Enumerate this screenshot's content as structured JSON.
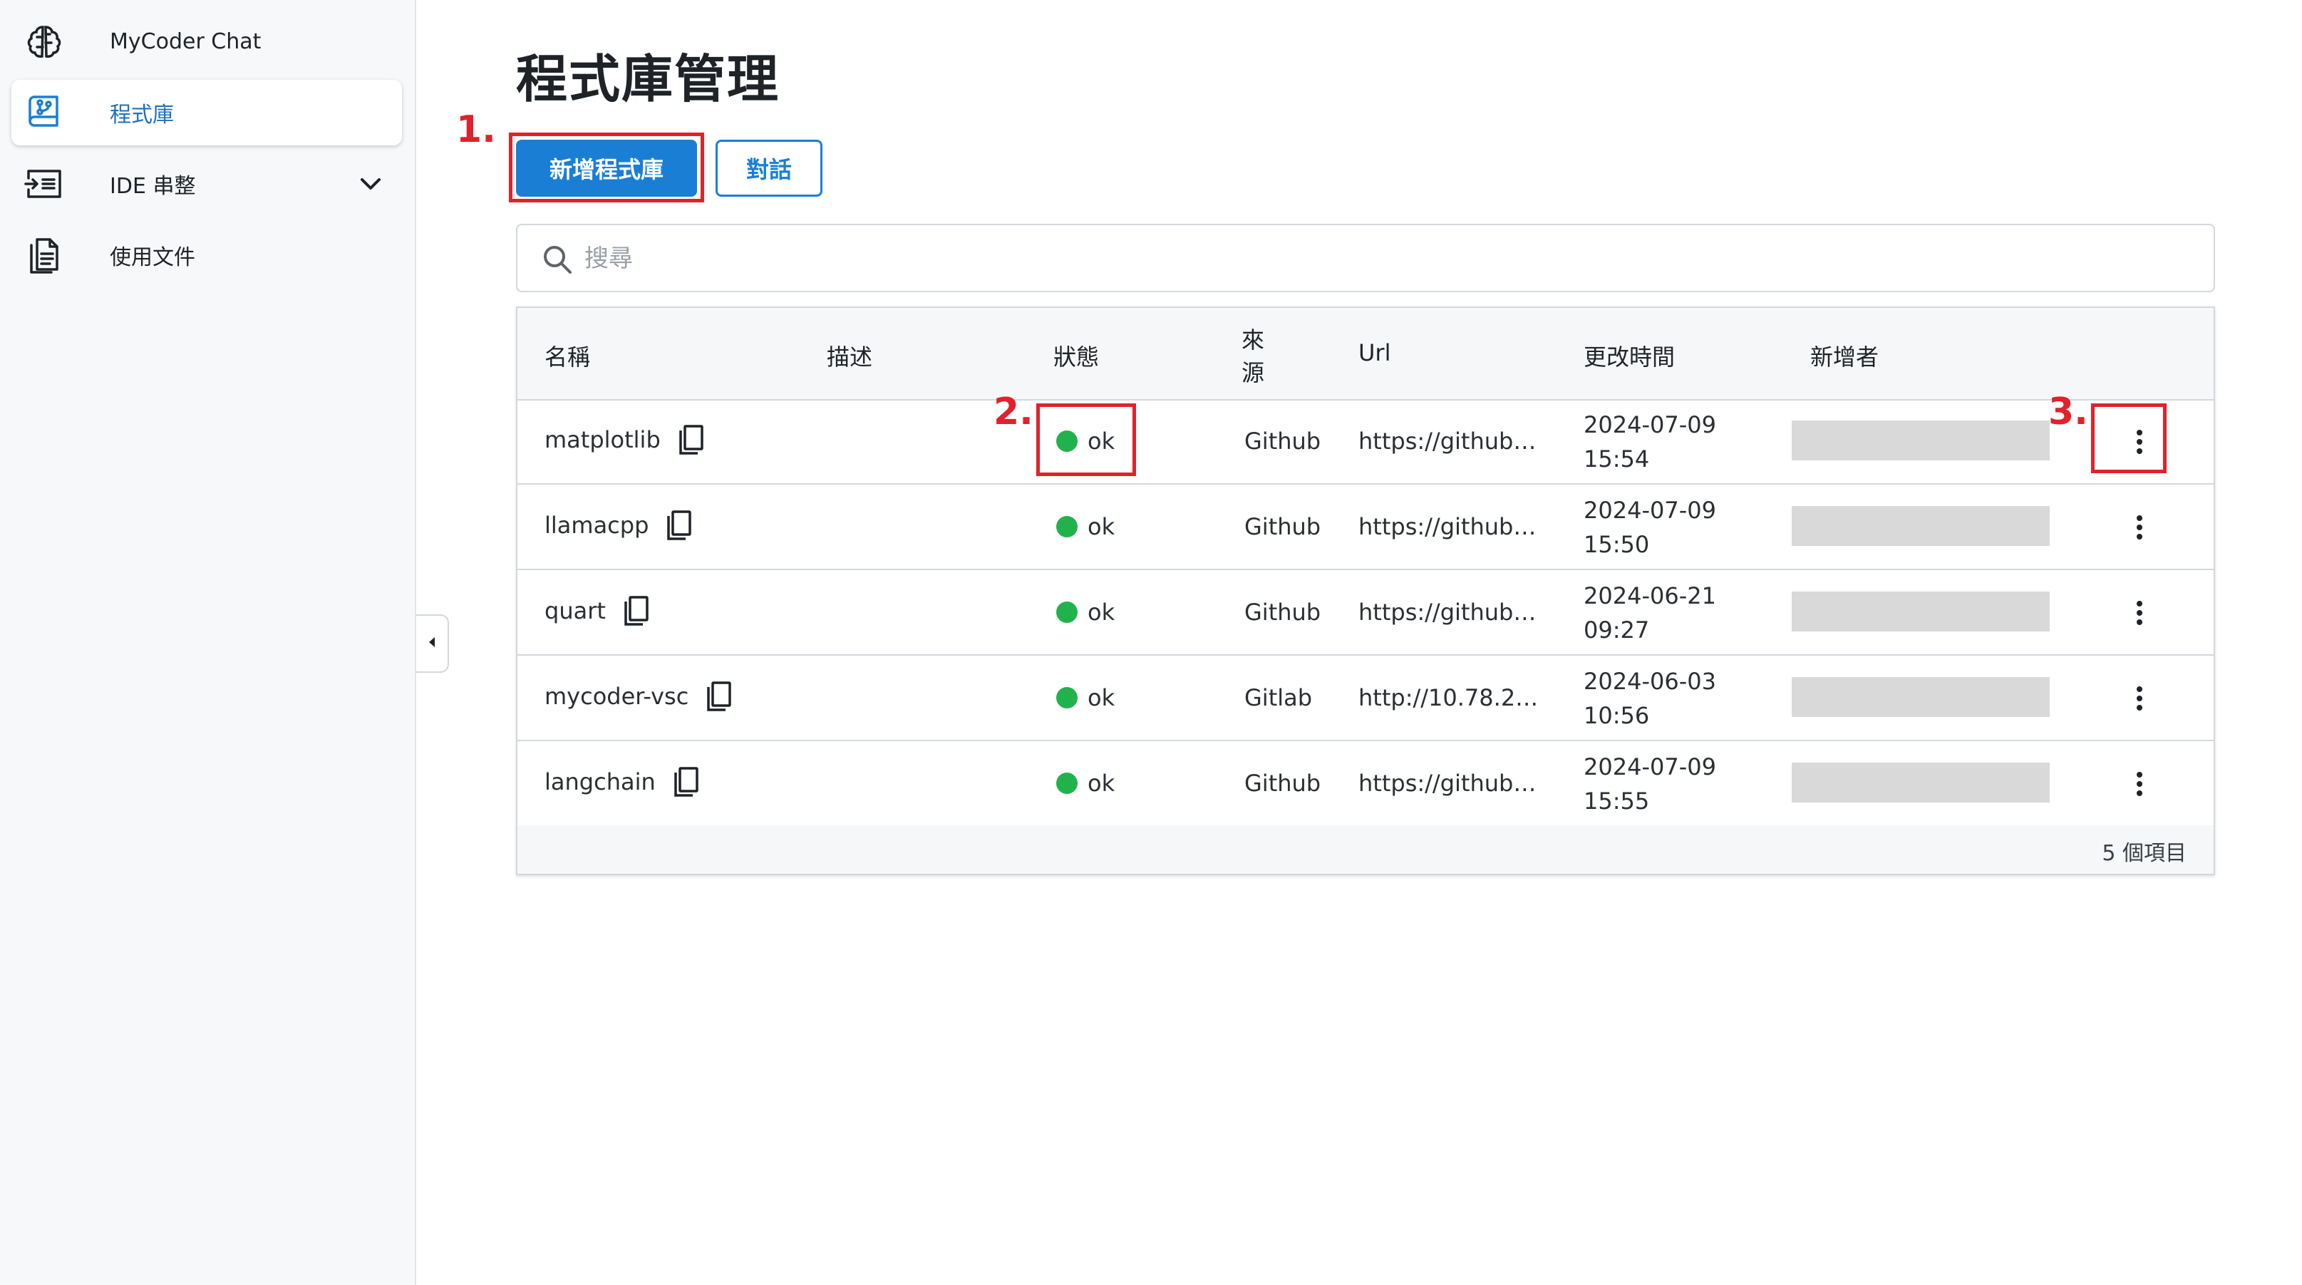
{
  "sidebar": {
    "items": [
      {
        "label": "MyCoder Chat",
        "icon": "brain-icon"
      },
      {
        "label": "程式庫",
        "icon": "repository-icon",
        "active": true
      },
      {
        "label": "IDE 串整",
        "icon": "ide-integration-icon",
        "expandable": true
      },
      {
        "label": "使用文件",
        "icon": "document-icon"
      }
    ]
  },
  "page": {
    "title": "程式庫管理",
    "add_button": "新增程式庫",
    "chat_button": "對話"
  },
  "annotations": {
    "step1": "1.",
    "step2": "2.",
    "step3": "3.",
    "color": "#e0222b"
  },
  "search": {
    "placeholder": "搜尋"
  },
  "table": {
    "columns": {
      "name": "名稱",
      "description": "描述",
      "status": "狀態",
      "source": "來源",
      "url": "Url",
      "updated": "更改時間",
      "creator": "新增者"
    },
    "rows": [
      {
        "name": "matplotlib",
        "description": "",
        "status": "ok",
        "source": "Github",
        "url": "https://github…",
        "date": "2024-07-09",
        "time": "15:54"
      },
      {
        "name": "llamacpp",
        "description": "",
        "status": "ok",
        "source": "Github",
        "url": "https://github…",
        "date": "2024-07-09",
        "time": "15:50"
      },
      {
        "name": "quart",
        "description": "",
        "status": "ok",
        "source": "Github",
        "url": "https://github…",
        "date": "2024-06-21",
        "time": "09:27"
      },
      {
        "name": "mycoder-vsc",
        "description": "",
        "status": "ok",
        "source": "Gitlab",
        "url": "http://10.78.2…",
        "date": "2024-06-03",
        "time": "10:56"
      },
      {
        "name": "langchain",
        "description": "",
        "status": "ok",
        "source": "Github",
        "url": "https://github…",
        "date": "2024-07-09",
        "time": "15:55"
      }
    ],
    "footer": "5 個項目"
  },
  "colors": {
    "primary": "#1a7fd4",
    "status_ok": "#22b24c",
    "annotation": "#e0222b"
  }
}
